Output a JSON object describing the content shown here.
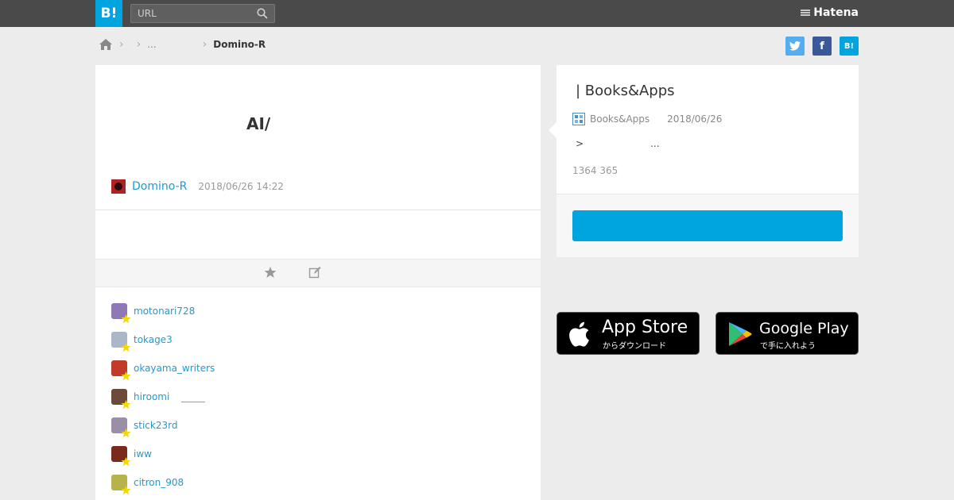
{
  "header": {
    "logo_text": "B!",
    "search_placeholder": "URL",
    "brand": "Hatena"
  },
  "breadcrumb": {
    "middle": "...",
    "current": "Domino-R"
  },
  "share": {
    "twitter": "t",
    "facebook": "f",
    "hatena": "B!"
  },
  "post": {
    "title": "AI/",
    "author": "Domino-R",
    "date": "2018/06/26 14:22"
  },
  "users": [
    {
      "name": "motonari728",
      "color": "#8e78b6"
    },
    {
      "name": "tokage3",
      "color": "#a9b7c8"
    },
    {
      "name": "okayama_writers",
      "color": "#c13a2a"
    },
    {
      "name": "hiroomi",
      "color": "#6b4a3a"
    },
    {
      "name": "stick23rd",
      "color": "#9a8fa6"
    },
    {
      "name": "iww",
      "color": "#7a2a1a"
    },
    {
      "name": "citron_908",
      "color": "#b7b34a"
    }
  ],
  "entry": {
    "title": "| Books&Apps",
    "site": "Books&Apps",
    "date": "2018/06/26",
    "excerpt_start": ">",
    "excerpt_end": "...",
    "counts": "1364 365"
  },
  "badges": {
    "apple_big": "App Store",
    "apple_small": "からダウンロード",
    "google_big": "Google Play",
    "google_small": "で手に入れよう"
  },
  "colors": {
    "accent": "#00a4de",
    "link": "#1f9bcf",
    "header_bg": "#4a4a4a"
  }
}
